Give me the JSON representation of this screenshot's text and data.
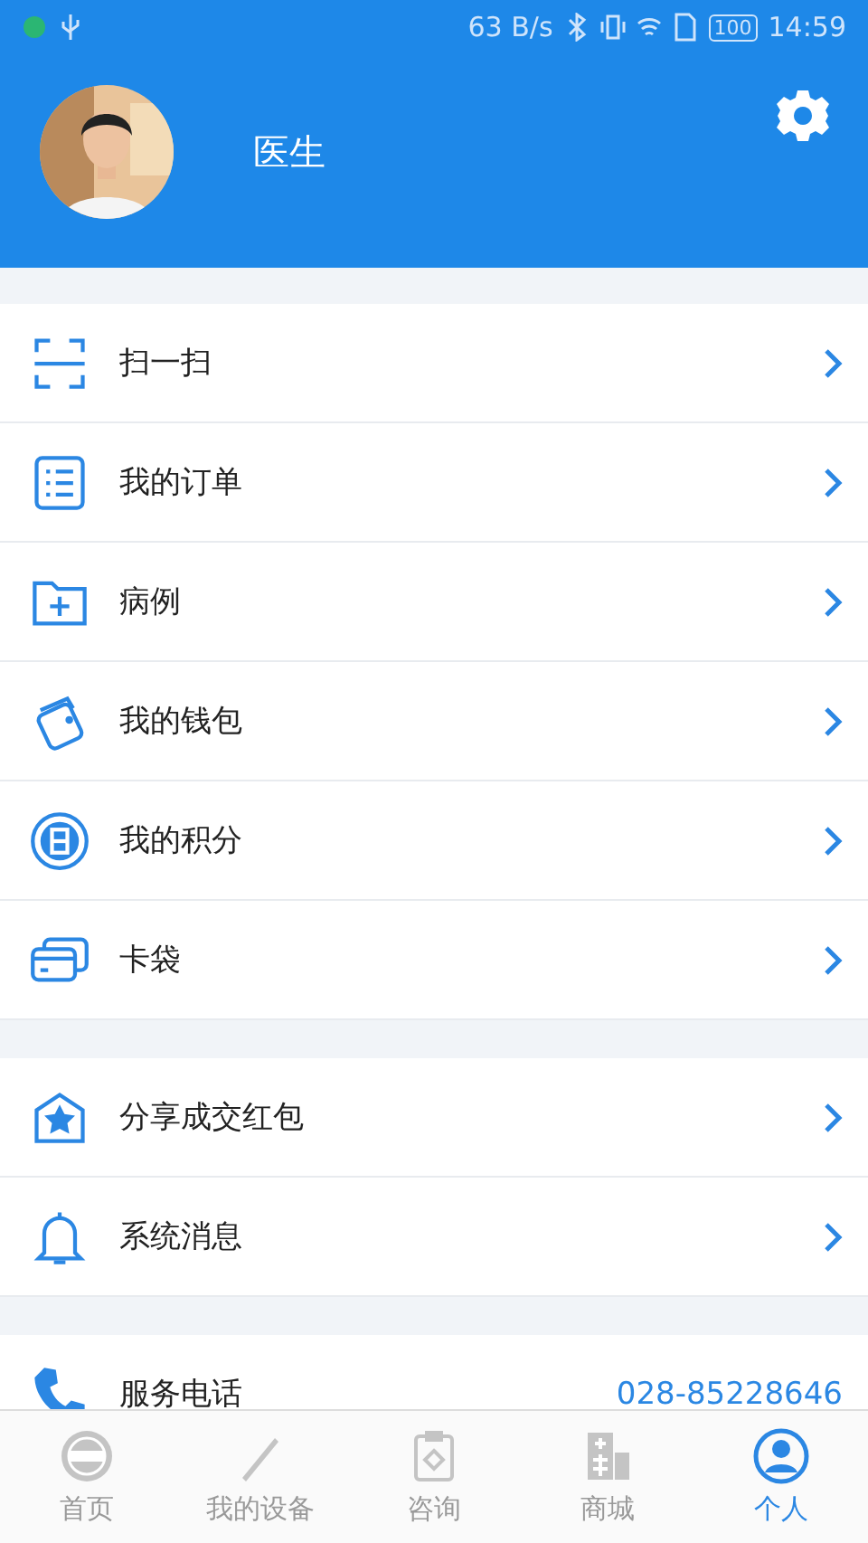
{
  "status_bar": {
    "speed": "63 B/s",
    "battery": "100",
    "time": "14:59"
  },
  "profile": {
    "name": "医生"
  },
  "sections": [
    {
      "items": [
        {
          "label": "扫一扫"
        },
        {
          "label": "我的订单"
        },
        {
          "label": "病例"
        },
        {
          "label": "我的钱包"
        },
        {
          "label": "我的积分"
        },
        {
          "label": "卡袋"
        }
      ]
    },
    {
      "items": [
        {
          "label": "分享成交红包"
        },
        {
          "label": "系统消息"
        }
      ]
    },
    {
      "items": [
        {
          "label": "服务电话",
          "value": "028-85228646"
        }
      ]
    }
  ],
  "nav": [
    {
      "label": "首页",
      "selected": false
    },
    {
      "label": "我的设备",
      "selected": false
    },
    {
      "label": "咨询",
      "selected": false
    },
    {
      "label": "商城",
      "selected": false
    },
    {
      "label": "个人",
      "selected": true
    }
  ]
}
